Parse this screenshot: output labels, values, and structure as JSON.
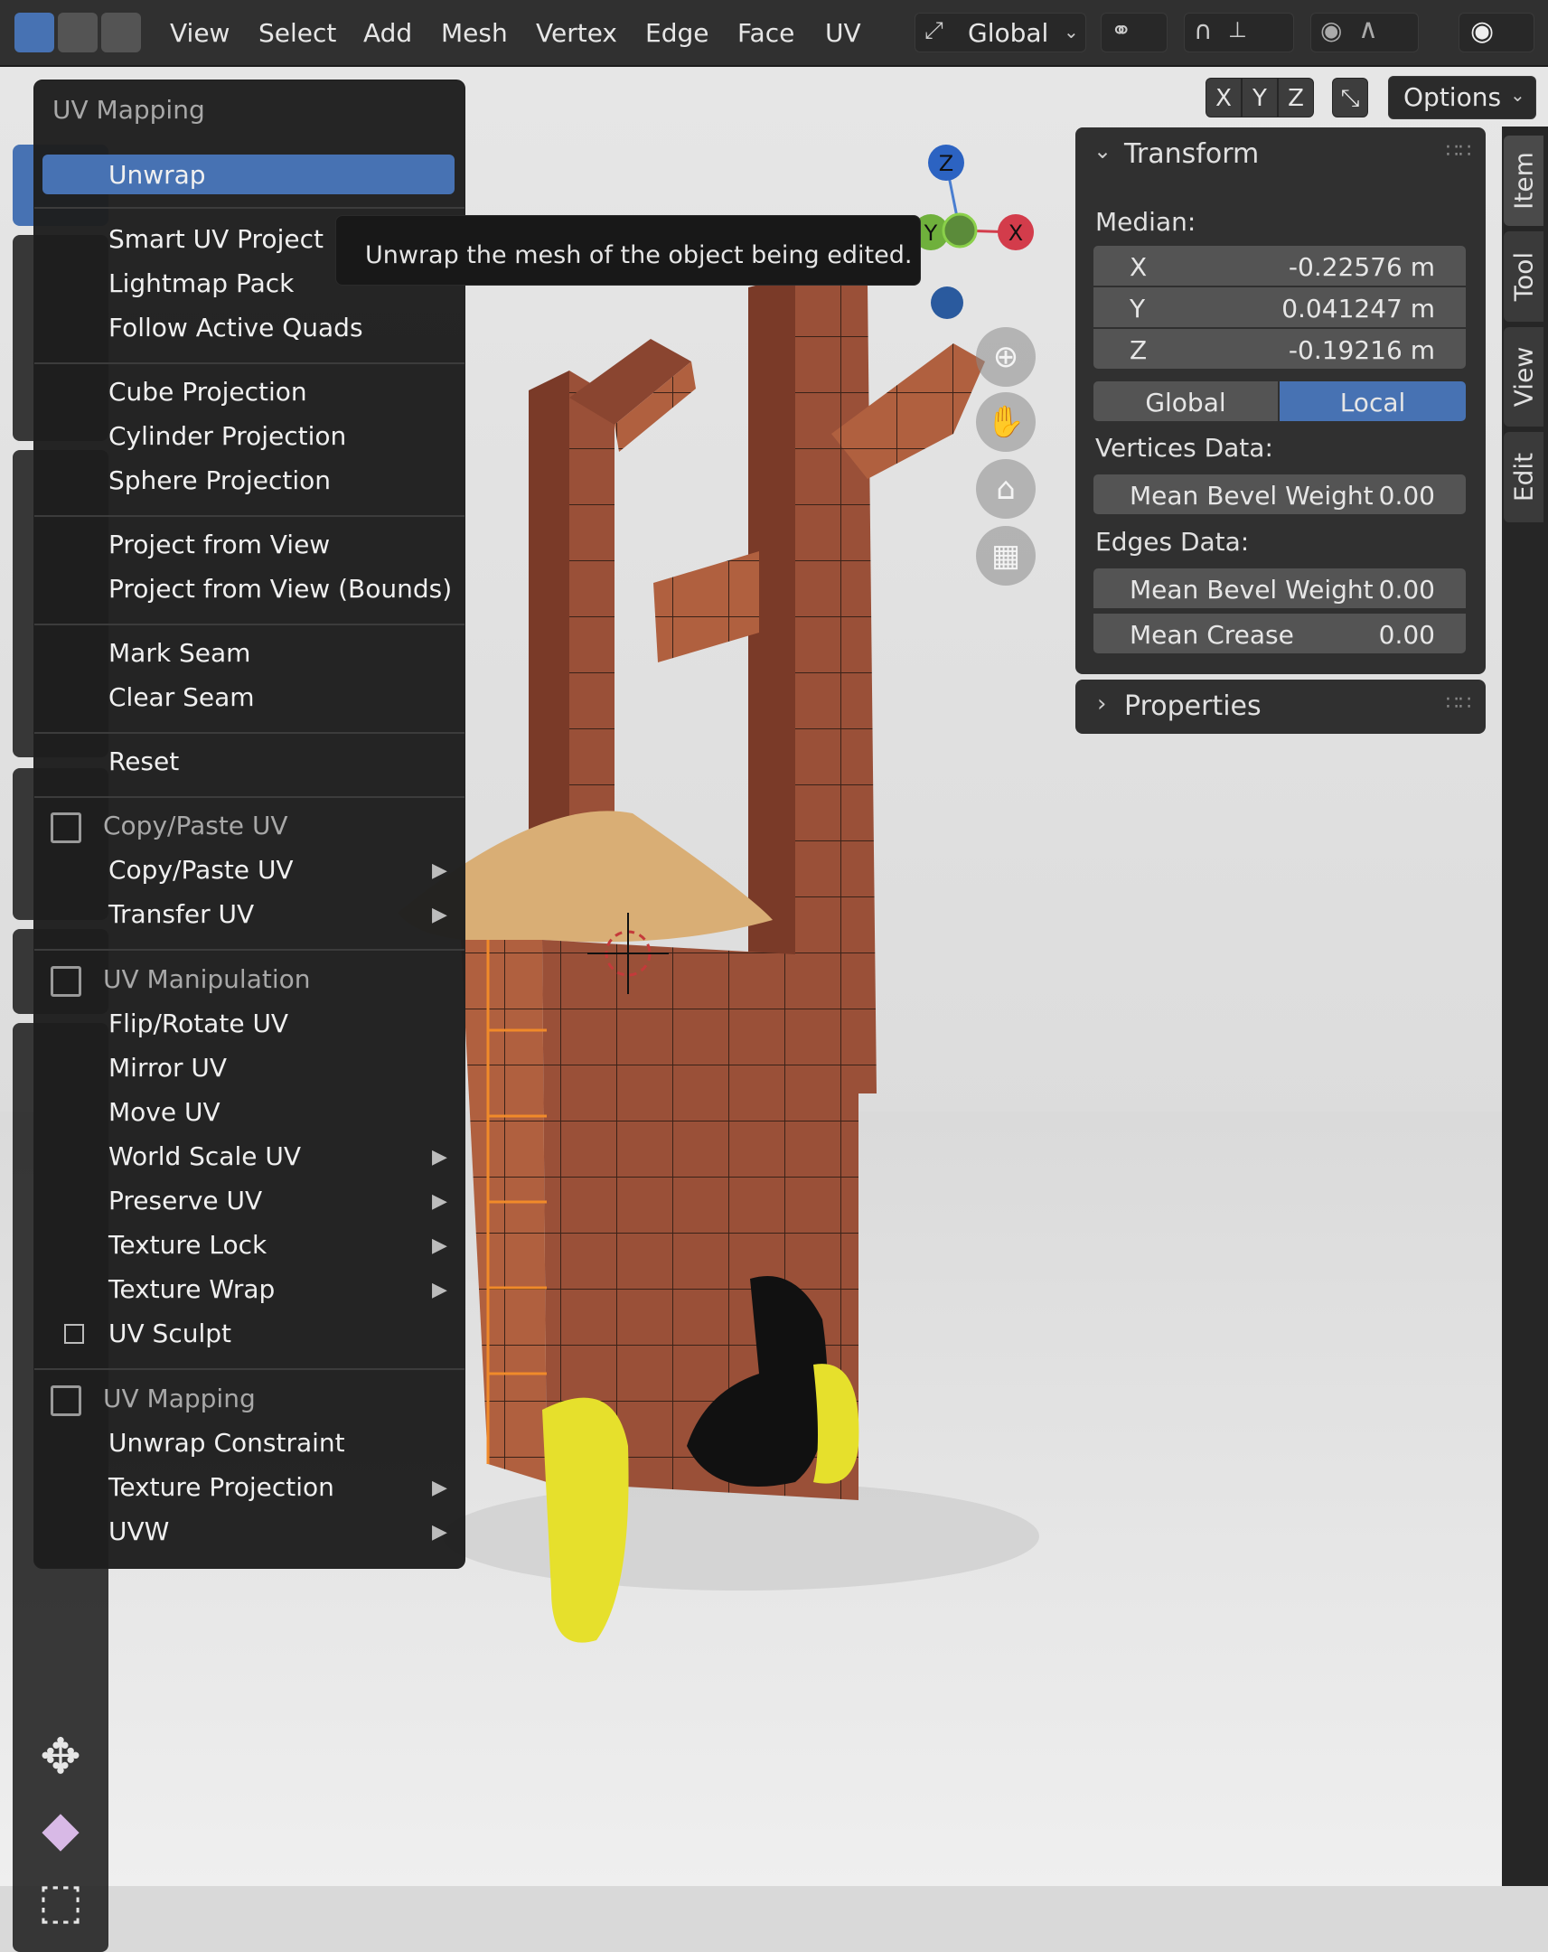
{
  "header": {
    "menus": [
      "View",
      "Select",
      "Add",
      "Mesh",
      "Vertex",
      "Edge",
      "Face",
      "UV"
    ],
    "orientation_label": "Global"
  },
  "subheader": {
    "axes": [
      "X",
      "Y",
      "Z"
    ],
    "options_label": "Options"
  },
  "gizmo": {
    "z": "Z",
    "y": "Y",
    "x": "X"
  },
  "menu": {
    "title": "UV Mapping",
    "items_group1": [
      "Unwrap"
    ],
    "items_group2": [
      "Smart UV Project",
      "Lightmap Pack",
      "Follow Active Quads"
    ],
    "items_group3": [
      "Cube Projection",
      "Cylinder Projection",
      "Sphere Projection"
    ],
    "items_group4": [
      "Project from View",
      "Project from View (Bounds)"
    ],
    "items_group5": [
      "Mark Seam",
      "Clear Seam"
    ],
    "items_group6": [
      "Reset"
    ],
    "section_copy_paste": {
      "title": "Copy/Paste UV",
      "items": [
        "Copy/Paste UV",
        "Transfer UV"
      ]
    },
    "section_manipulation": {
      "title": "UV Manipulation",
      "items": [
        "Flip/Rotate UV",
        "Mirror UV",
        "Move UV",
        "World Scale UV",
        "Preserve UV",
        "Texture Lock",
        "Texture Wrap",
        "UV Sculpt"
      ]
    },
    "section_mapping": {
      "title": "UV Mapping",
      "items": [
        "Unwrap Constraint",
        "Texture Projection",
        "UVW"
      ]
    }
  },
  "tooltip": "Unwrap the mesh of the object being edited.",
  "transform_panel": {
    "title": "Transform",
    "median_label": "Median:",
    "x_label": "X",
    "x_value": "-0.22576 m",
    "y_label": "Y",
    "y_value": "0.041247 m",
    "z_label": "Z",
    "z_value": "-0.19216 m",
    "global_label": "Global",
    "local_label": "Local",
    "vertices_label": "Vertices Data:",
    "vertex_bevel_label": "Mean Bevel Weight",
    "vertex_bevel_value": "0.00",
    "edges_label": "Edges Data:",
    "edge_bevel_label": "Mean Bevel Weight",
    "edge_bevel_value": "0.00",
    "crease_label": "Mean Crease",
    "crease_value": "0.00"
  },
  "properties_panel": {
    "title": "Properties"
  },
  "side_tabs": [
    "Item",
    "Tool",
    "View",
    "Edit"
  ],
  "colors": {
    "accent": "#4772b3",
    "menu_bg": "#1e1e1e",
    "panel_bg": "#303030",
    "field_bg": "#545454"
  }
}
